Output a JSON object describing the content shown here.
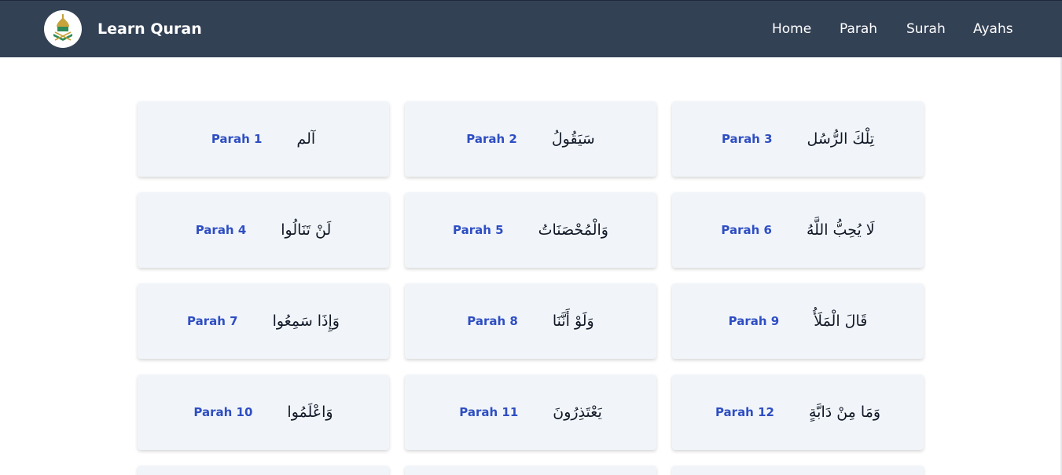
{
  "brand": {
    "name": "Learn Quran",
    "logo_icon": "quran-mosque-logo-icon"
  },
  "nav": [
    {
      "label": "Home"
    },
    {
      "label": "Parah"
    },
    {
      "label": "Surah"
    },
    {
      "label": "Ayahs"
    }
  ],
  "colors": {
    "navbar": "#334155",
    "card": "#f1f5f9",
    "accent": "#2f4ec3"
  },
  "parahs": [
    {
      "label": "Parah 1",
      "arabic": "آلم"
    },
    {
      "label": "Parah 2",
      "arabic": "سَيَقُولُ"
    },
    {
      "label": "Parah 3",
      "arabic": "تِلْكَ الرُّسُل"
    },
    {
      "label": "Parah 4",
      "arabic": "لَنْ تَنَالُوا"
    },
    {
      "label": "Parah 5",
      "arabic": "وَالْمُحْصَنَاتُ"
    },
    {
      "label": "Parah 6",
      "arabic": "لَا يُحِبُّ اللَّهُ"
    },
    {
      "label": "Parah 7",
      "arabic": "وَإِذَا سَمِعُوا"
    },
    {
      "label": "Parah 8",
      "arabic": "وَلَوْ أَنَّنَا"
    },
    {
      "label": "Parah 9",
      "arabic": "قَالَ الْمَلَأُ"
    },
    {
      "label": "Parah 10",
      "arabic": "وَاعْلَمُوا"
    },
    {
      "label": "Parah 11",
      "arabic": "يَعْتَذِرُونَ"
    },
    {
      "label": "Parah 12",
      "arabic": "وَمَا مِنْ دَابَّةٍ"
    },
    {
      "label": "",
      "arabic": ""
    },
    {
      "label": "",
      "arabic": ""
    },
    {
      "label": "",
      "arabic": ""
    }
  ]
}
